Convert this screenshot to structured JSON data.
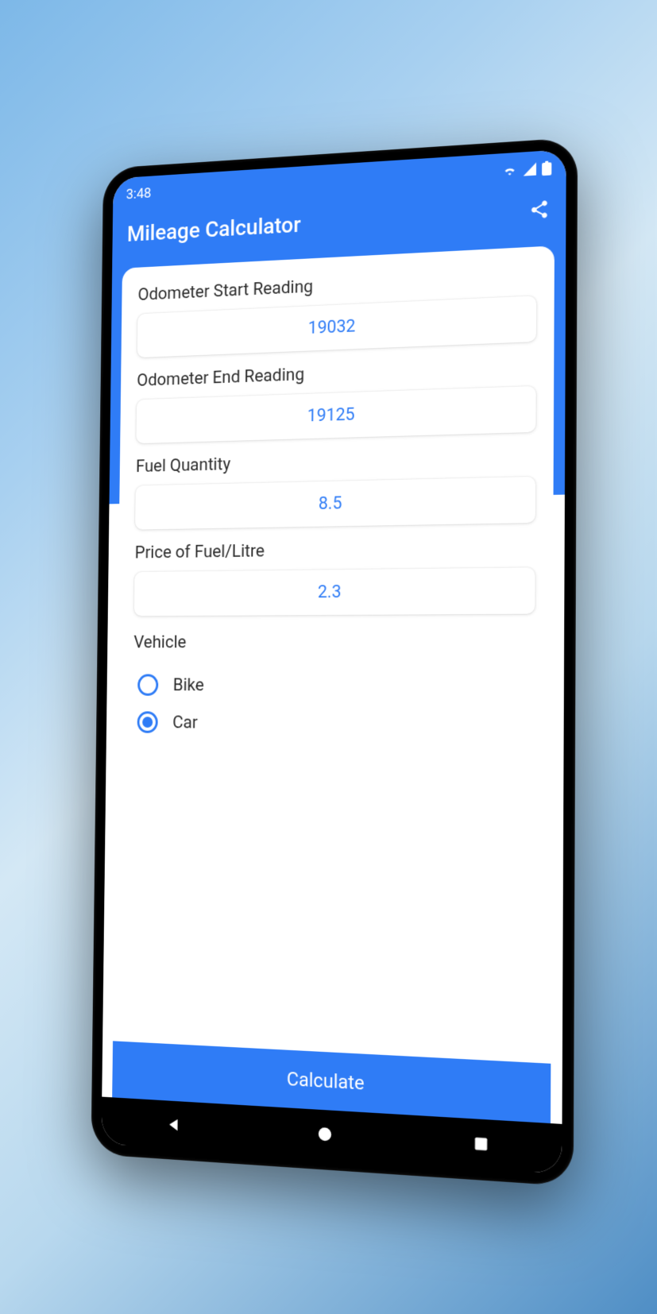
{
  "statusbar": {
    "time": "3:48"
  },
  "appbar": {
    "title": "Mileage Calculator"
  },
  "fields": {
    "odo_start": {
      "label": "Odometer Start Reading",
      "value": "19032"
    },
    "odo_end": {
      "label": "Odometer End Reading",
      "value": "19125"
    },
    "fuel_qty": {
      "label": "Fuel Quantity",
      "value": "8.5"
    },
    "fuel_price": {
      "label": "Price of Fuel/Litre",
      "value": "2.3"
    }
  },
  "vehicle": {
    "label": "Vehicle",
    "options": [
      {
        "label": "Bike",
        "selected": false
      },
      {
        "label": "Car",
        "selected": true
      }
    ]
  },
  "calculate_label": "Calculate"
}
